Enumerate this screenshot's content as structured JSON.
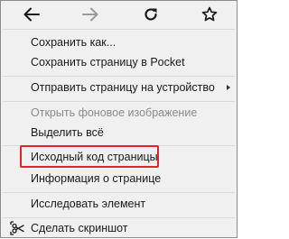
{
  "navbar": {
    "back_icon": "arrow-left-icon",
    "forward_icon": "arrow-right-icon",
    "reload_icon": "reload-icon",
    "bookmark_icon": "star-icon"
  },
  "menu": {
    "items": [
      {
        "label": "Сохранить как...",
        "disabled": false
      },
      {
        "label": "Сохранить страницу в Pocket",
        "disabled": false
      },
      {
        "label": "Отправить страницу на устройство",
        "disabled": false,
        "submenu": true
      },
      {
        "label": "Открыть фоновое изображение",
        "disabled": true
      },
      {
        "label": "Выделить всё",
        "disabled": false
      },
      {
        "label": "Исходный код страницы",
        "disabled": false,
        "highlighted": true
      },
      {
        "label": "Информация о странице",
        "disabled": false
      },
      {
        "label": "Исследовать элемент",
        "disabled": false
      },
      {
        "label": "Сделать скриншот",
        "disabled": false,
        "icon": "screenshot-scissors-icon"
      }
    ]
  },
  "colors": {
    "highlight_border": "#e0262c",
    "menu_background": "#f0f0f0",
    "disabled_text": "#8a8a8a"
  }
}
